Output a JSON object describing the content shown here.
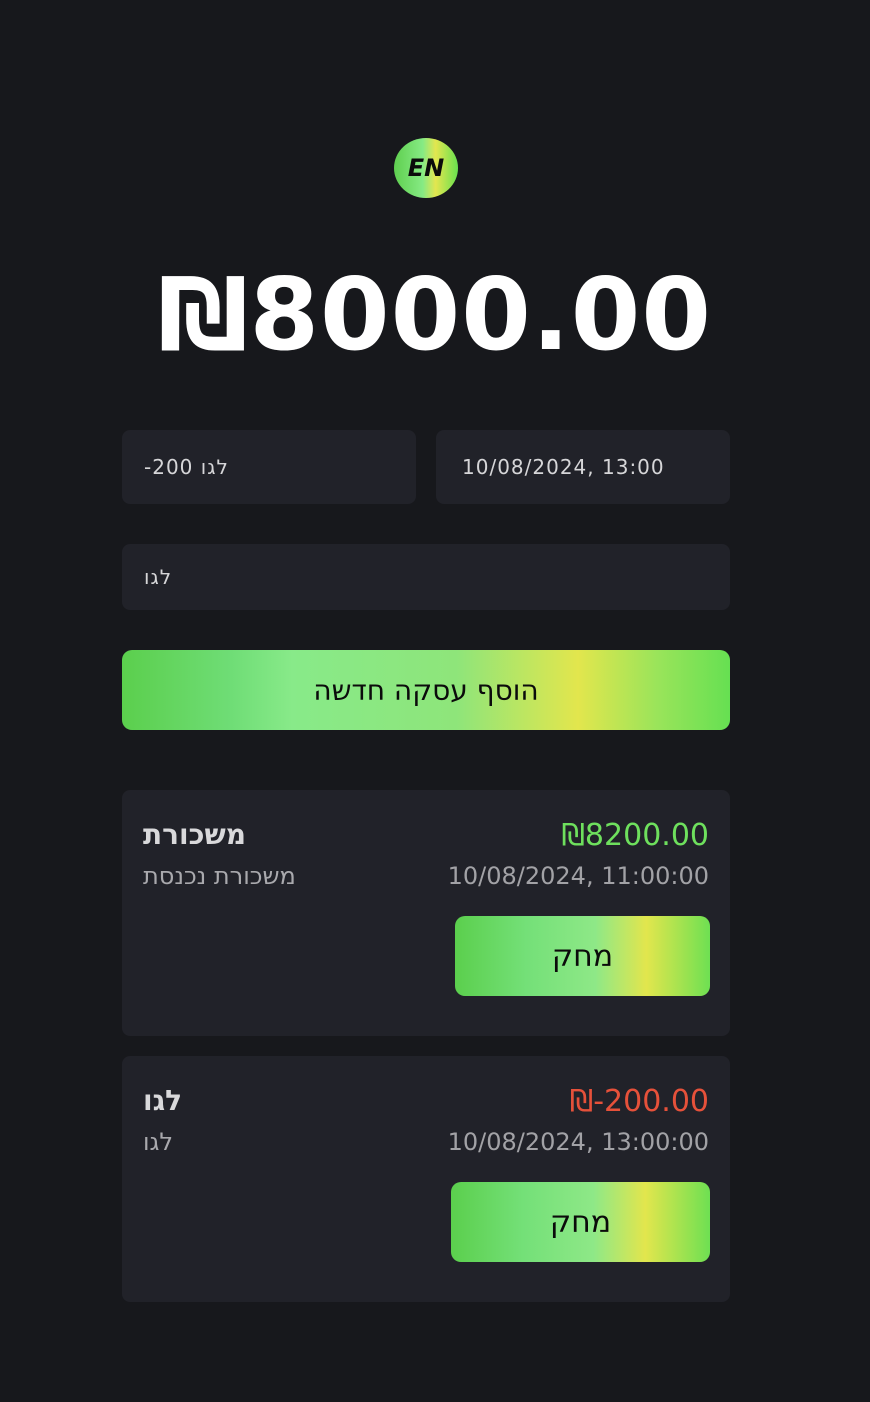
{
  "language_toggle": {
    "label": "EN"
  },
  "balance": {
    "value": "₪8000.00"
  },
  "form": {
    "amount_value": "-200 לגו",
    "datetime_value": "10/08/2024, 13:00",
    "description_value": "לגו",
    "submit_label": "הוסף עסקה חדשה"
  },
  "transactions": [
    {
      "title": "משכורת",
      "description": "משכורת נכנסת",
      "amount": "₪8200.00",
      "datetime": "10/08/2024, 11:00:00",
      "delete_label": "מחק",
      "amount_color": "#6ee05d"
    },
    {
      "title": "לגו",
      "description": "לגו",
      "amount": "₪-200.00",
      "datetime": "10/08/2024, 13:00:00",
      "delete_label": "מחק",
      "amount_color": "#e6513a"
    }
  ],
  "colors": {
    "background": "#17181c",
    "card": "#212229",
    "positive": "#6ee05d",
    "negative": "#e6513a"
  }
}
